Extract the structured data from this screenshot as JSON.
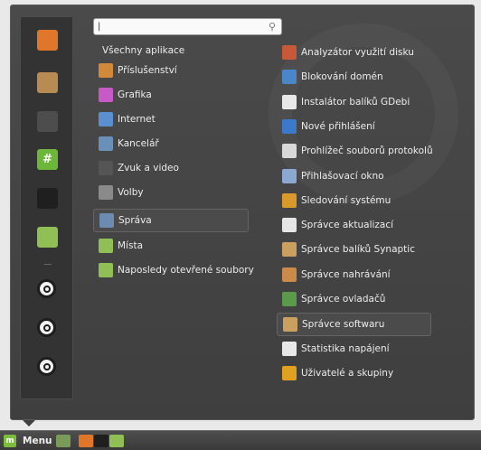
{
  "search": {
    "value": "",
    "placeholder": ""
  },
  "favorites": [
    {
      "name": "firefox-icon",
      "color": "#e0762a"
    },
    {
      "name": "package-icon",
      "color": "#b88b52"
    },
    {
      "name": "system-settings-icon",
      "color": "#4d4d4d"
    },
    {
      "name": "terminal-hash-icon",
      "color": "#6cb63a",
      "glyph": "#"
    },
    {
      "name": "terminal-icon",
      "color": "#1f1f1f"
    },
    {
      "name": "folder-icon",
      "color": "#8fbf55"
    },
    {
      "name": "lock-screen-icon"
    },
    {
      "name": "logout-icon"
    },
    {
      "name": "shutdown-icon"
    }
  ],
  "categories_header": "Všechny aplikace",
  "categories": [
    {
      "label": "Příslušenství",
      "icon": "accessories-icon",
      "color": "#d28a3a"
    },
    {
      "label": "Grafika",
      "icon": "graphics-icon",
      "color": "#c85ac8"
    },
    {
      "label": "Internet",
      "icon": "internet-icon",
      "color": "#5a8fd0"
    },
    {
      "label": "Kancelář",
      "icon": "office-icon",
      "color": "#6a8fb8"
    },
    {
      "label": "Zvuk a video",
      "icon": "sound-video-icon",
      "color": "#555555"
    },
    {
      "label": "Volby",
      "icon": "preferences-icon",
      "color": "#8a8a8a"
    },
    {
      "label": "Správa",
      "icon": "administration-icon",
      "color": "#6c8bb0",
      "selected": true
    },
    {
      "label": "Místa",
      "icon": "places-folder-icon",
      "color": "#8fbf55"
    },
    {
      "label": "Naposledy otevřené soubory",
      "icon": "recent-files-icon",
      "color": "#8fbf55"
    }
  ],
  "applications": [
    {
      "label": "Analyzátor využití disku",
      "icon": "disk-usage-icon",
      "color": "#c8583a"
    },
    {
      "label": "Blokování domén",
      "icon": "domain-blocker-icon",
      "color": "#4a86c8"
    },
    {
      "label": "Instalátor balíků GDebi",
      "icon": "gdebi-icon",
      "color": "#e8e8e8"
    },
    {
      "label": "Nové přihlášení",
      "icon": "new-login-icon",
      "color": "#3a7ac8"
    },
    {
      "label": "Prohlížeč souborů protokolů",
      "icon": "log-viewer-icon",
      "color": "#d8d8d8"
    },
    {
      "label": "Přihlašovací okno",
      "icon": "login-window-icon",
      "color": "#8aa8d0"
    },
    {
      "label": "Sledování systému",
      "icon": "system-monitor-icon",
      "color": "#d89a2a"
    },
    {
      "label": "Správce aktualizací",
      "icon": "update-manager-icon",
      "color": "#e6e6e6"
    },
    {
      "label": "Správce balíků Synaptic",
      "icon": "synaptic-icon",
      "color": "#c9a060"
    },
    {
      "label": "Správce nahrávání",
      "icon": "upload-manager-icon",
      "color": "#c98a4a"
    },
    {
      "label": "Správce ovladačů",
      "icon": "driver-manager-icon",
      "color": "#5a9a4a"
    },
    {
      "label": "Správce softwaru",
      "icon": "software-manager-icon",
      "color": "#c9a060",
      "selected": true
    },
    {
      "label": "Statistika napájení",
      "icon": "power-statistics-icon",
      "color": "#e8e8e8"
    },
    {
      "label": "Uživatelé a skupiny",
      "icon": "users-groups-icon",
      "color": "#e0a020"
    }
  ],
  "panel": {
    "menu_label": "Menu",
    "launchers": [
      {
        "name": "show-desktop-icon",
        "color": "#7a9a5a"
      },
      {
        "name": "firefox-launcher-icon",
        "color": "#e0762a"
      },
      {
        "name": "terminal-launcher-icon",
        "color": "#1f1f1f"
      },
      {
        "name": "files-launcher-icon",
        "color": "#8fbf55"
      }
    ]
  }
}
